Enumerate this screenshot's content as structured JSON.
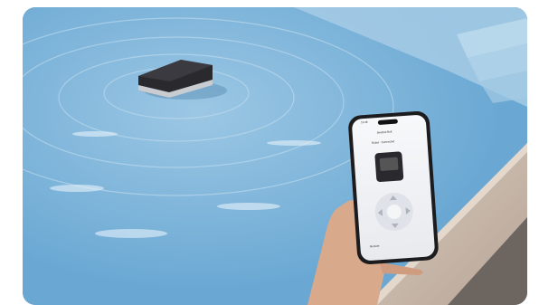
{
  "scene": {
    "description_type": "photo",
    "colors": {
      "water": "#7db4da",
      "water_light": "#b9d4e8",
      "deck": "#c9b8aa",
      "robot": "#2a2a2e",
      "phone_frame": "#1c1c1e",
      "phone_screen": "#f2f3f5",
      "skin": "#d9a98c"
    }
  },
  "phone": {
    "status_time": "12:48",
    "header_title": "Beetbot Bolt",
    "sub_label": "Robot · Connected",
    "bottom_label": "Remote"
  }
}
